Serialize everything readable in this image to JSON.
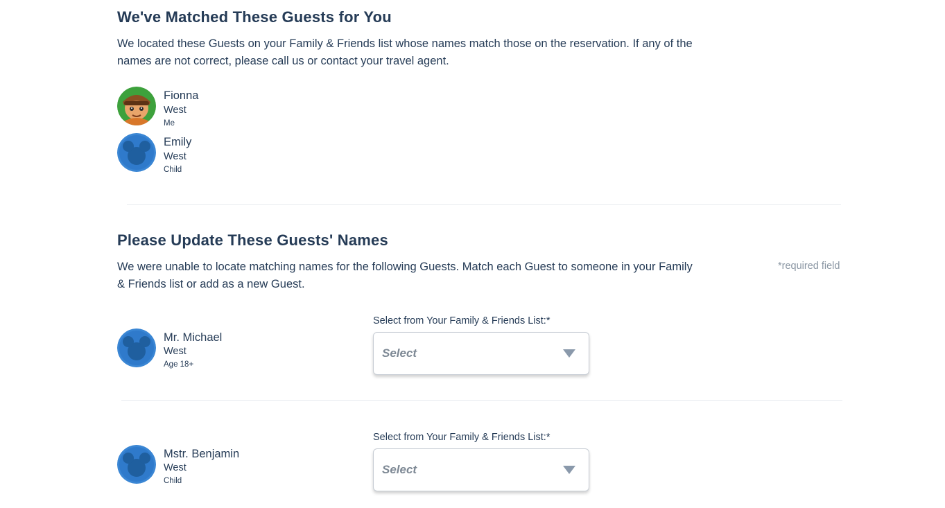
{
  "matched": {
    "title": "We've Matched These Guests for You",
    "description": "We located these Guests on your Family & Friends list whose names match those on the reservation. If any of the names are not correct, please call us or contact your travel agent.",
    "guests": [
      {
        "first": "Fionna",
        "last": "West",
        "relation": "Me",
        "avatar": "character-avatar-icon"
      },
      {
        "first": "Emily",
        "last": "West",
        "relation": "Child",
        "avatar": "mickey-avatar-icon"
      }
    ]
  },
  "update": {
    "title": "Please Update These Guests' Names",
    "description": "We were unable to locate matching names for the following Guests. Match each Guest to someone in your Family & Friends list or add as a new Guest.",
    "required_note": "*required field",
    "guests": [
      {
        "first": "Mr. Michael",
        "last": "West",
        "relation": "Age 18+",
        "select_label": "Select from Your Family & Friends List:*",
        "select_value": "Select",
        "avatar": "mickey-avatar-icon"
      },
      {
        "first": "Mstr. Benjamin",
        "last": "West",
        "relation": "Child",
        "select_label": "Select from Your Family & Friends List:*",
        "select_value": "Select",
        "avatar": "mickey-avatar-icon"
      }
    ]
  },
  "colors": {
    "text": "#253b56",
    "muted": "#8a96a3",
    "avatar_blue": "#2f7fd0",
    "divider": "#e8ecf0"
  }
}
